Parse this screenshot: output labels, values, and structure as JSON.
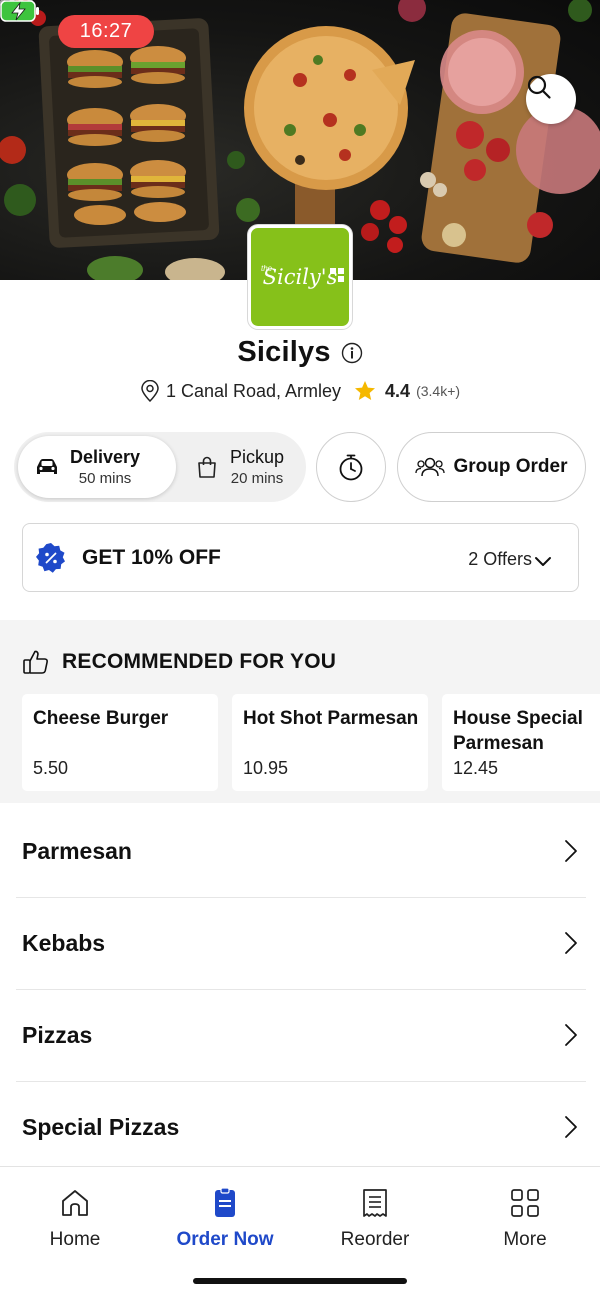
{
  "status_bar": {
    "time": "16:27"
  },
  "restaurant": {
    "logo_text": "Sicily's",
    "logo_prefix": "the",
    "name": "Sicilys",
    "address": "1 Canal Road, Armley",
    "rating": "4.4",
    "rating_count": "(3.4k+)"
  },
  "order_mode": {
    "delivery": {
      "label": "Delivery",
      "time": "50 mins"
    },
    "pickup": {
      "label": "Pickup",
      "time": "20 mins"
    },
    "group_order_label": "Group Order"
  },
  "offer": {
    "title": "GET 10% OFF",
    "count_label": "2 Offers"
  },
  "recommended": {
    "heading": "RECOMMENDED FOR YOU",
    "items": [
      {
        "name": "Cheese Burger",
        "price": "5.50"
      },
      {
        "name": "Hot Shot Parmesan",
        "price": "10.95"
      },
      {
        "name": "House Special Parmesan",
        "price": "12.45"
      }
    ]
  },
  "categories": [
    "Parmesan",
    "Kebabs",
    "Pizzas",
    "Special Pizzas"
  ],
  "tabbar": {
    "items": [
      {
        "label": "Home",
        "icon": "home-icon"
      },
      {
        "label": "Order Now",
        "icon": "order-icon"
      },
      {
        "label": "Reorder",
        "icon": "receipt-icon"
      },
      {
        "label": "More",
        "icon": "grid-icon"
      }
    ],
    "active": "Order Now"
  },
  "colors": {
    "accent": "#1f49c9",
    "logo_green": "#86c11a",
    "star": "#f5b800",
    "time_pill": "#ef4444"
  }
}
